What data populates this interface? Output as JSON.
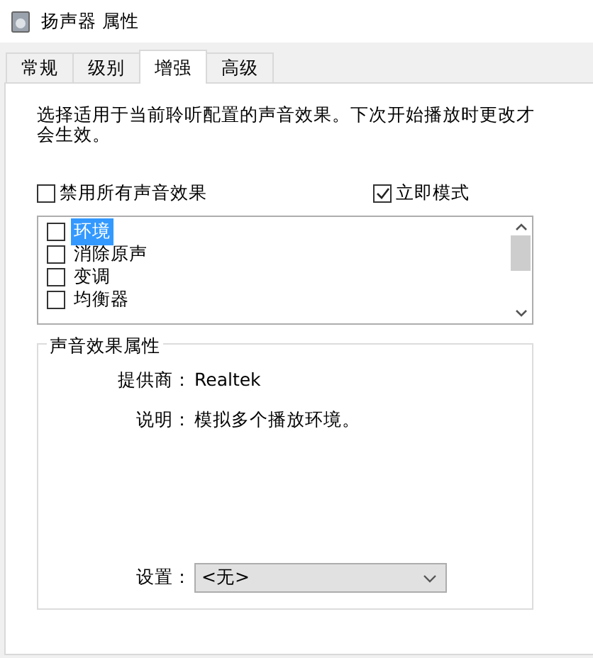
{
  "window": {
    "title": "扬声器 属性"
  },
  "tabs": [
    {
      "label": "常规",
      "selected": false
    },
    {
      "label": "级别",
      "selected": false
    },
    {
      "label": "增强",
      "selected": true
    },
    {
      "label": "高级",
      "selected": false
    }
  ],
  "description": "选择适用于当前聆听配置的声音效果。下次开始播放时更改才会生效。",
  "options": [
    {
      "label": "禁用所有声音效果",
      "checked": false
    },
    {
      "label": "立即模式",
      "checked": true
    }
  ],
  "effects": [
    {
      "label": "环境",
      "checked": false,
      "selected": true
    },
    {
      "label": "消除原声",
      "checked": false,
      "selected": false
    },
    {
      "label": "变调",
      "checked": false,
      "selected": false
    },
    {
      "label": "均衡器",
      "checked": false,
      "selected": false
    }
  ],
  "properties": {
    "title": "声音效果属性",
    "fields": [
      {
        "label": "提供商：",
        "value": "Realtek"
      },
      {
        "label": "说明：",
        "value": "模拟多个播放环境。"
      }
    ],
    "setting": {
      "label": "设置：",
      "value": "<无>"
    }
  }
}
